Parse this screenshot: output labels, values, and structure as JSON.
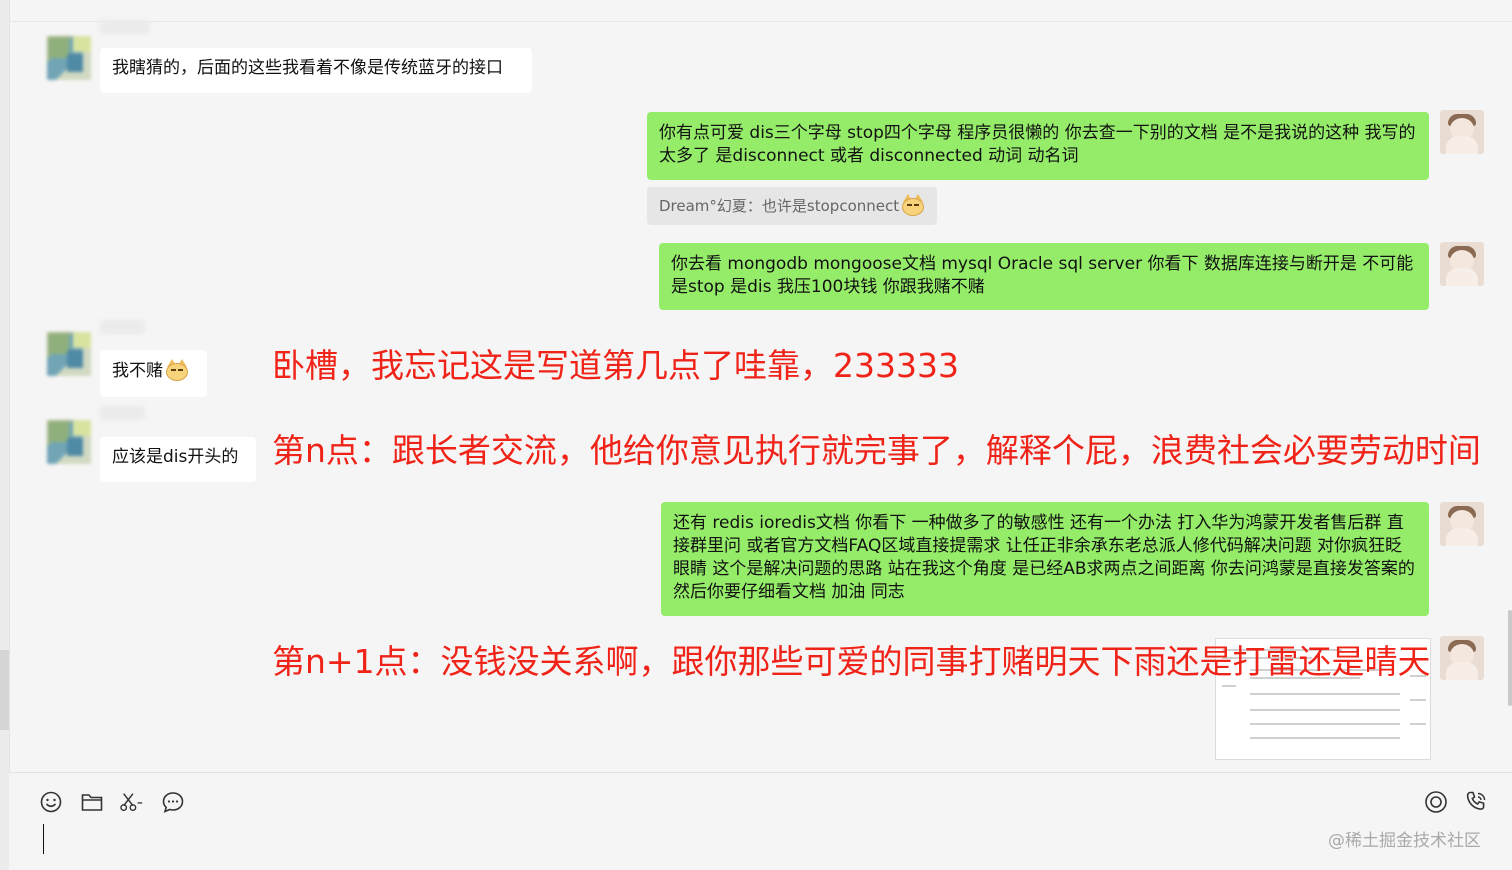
{
  "messages": {
    "m1": "我瞎猜的，后面的这些我看着不像是传统蓝牙的接口",
    "m2": "你有点可爱  dis三个字母  stop四个字母 程序员很懒的 你去查一下别的文档 是不是我说的这种 我写的太多了 是disconnect 或者 disconnected  动词  动名词",
    "m3_quote": "Dream°幻夏：也许是stopconnect",
    "m4": "你去看 mongodb mongoose文档  mysql  Oracle sql server 你看下 数据库连接与断开是 不可能是stop  是dis  我压100块钱 你跟我赌不赌",
    "m5": "我不赌",
    "m6": "应该是dis开头的",
    "m7": "还有 redis ioredis文档 你看下 一种做多了的敏感性  还有一个办法 打入华为鸿蒙开发者售后群 直接群里问 或者官方文档FAQ区域直接提需求 让任正非余承东老总派人修代码解决问题 对你疯狂眨眼睛 这个是解决问题的思路 站在我这个角度  是已经AB求两点之间距离  你去问鸿蒙是直接发答案的 然后你要仔细看文档 加油 同志"
  },
  "annotations": {
    "a1": "卧槽，我忘记这是写道第几点了哇靠，233333",
    "a2": "第n点：跟长者交流，他给你意见执行就完事了，解释个屁，浪费社会必要劳动时间",
    "a3": "第n+1点：没钱没关系啊，跟你那些可爱的同事打赌明天下雨还是打雷还是晴天"
  },
  "watermark": "@稀土掘金技术社区",
  "colors": {
    "outgoing_bubble": "#95ec69",
    "incoming_bubble": "#ffffff",
    "annotation_red": "#f02318"
  },
  "toolbar_icons": [
    "emoji-icon",
    "folder-icon",
    "scissors-icon",
    "chat-icon",
    "voice-call-icon",
    "phone-call-icon"
  ]
}
